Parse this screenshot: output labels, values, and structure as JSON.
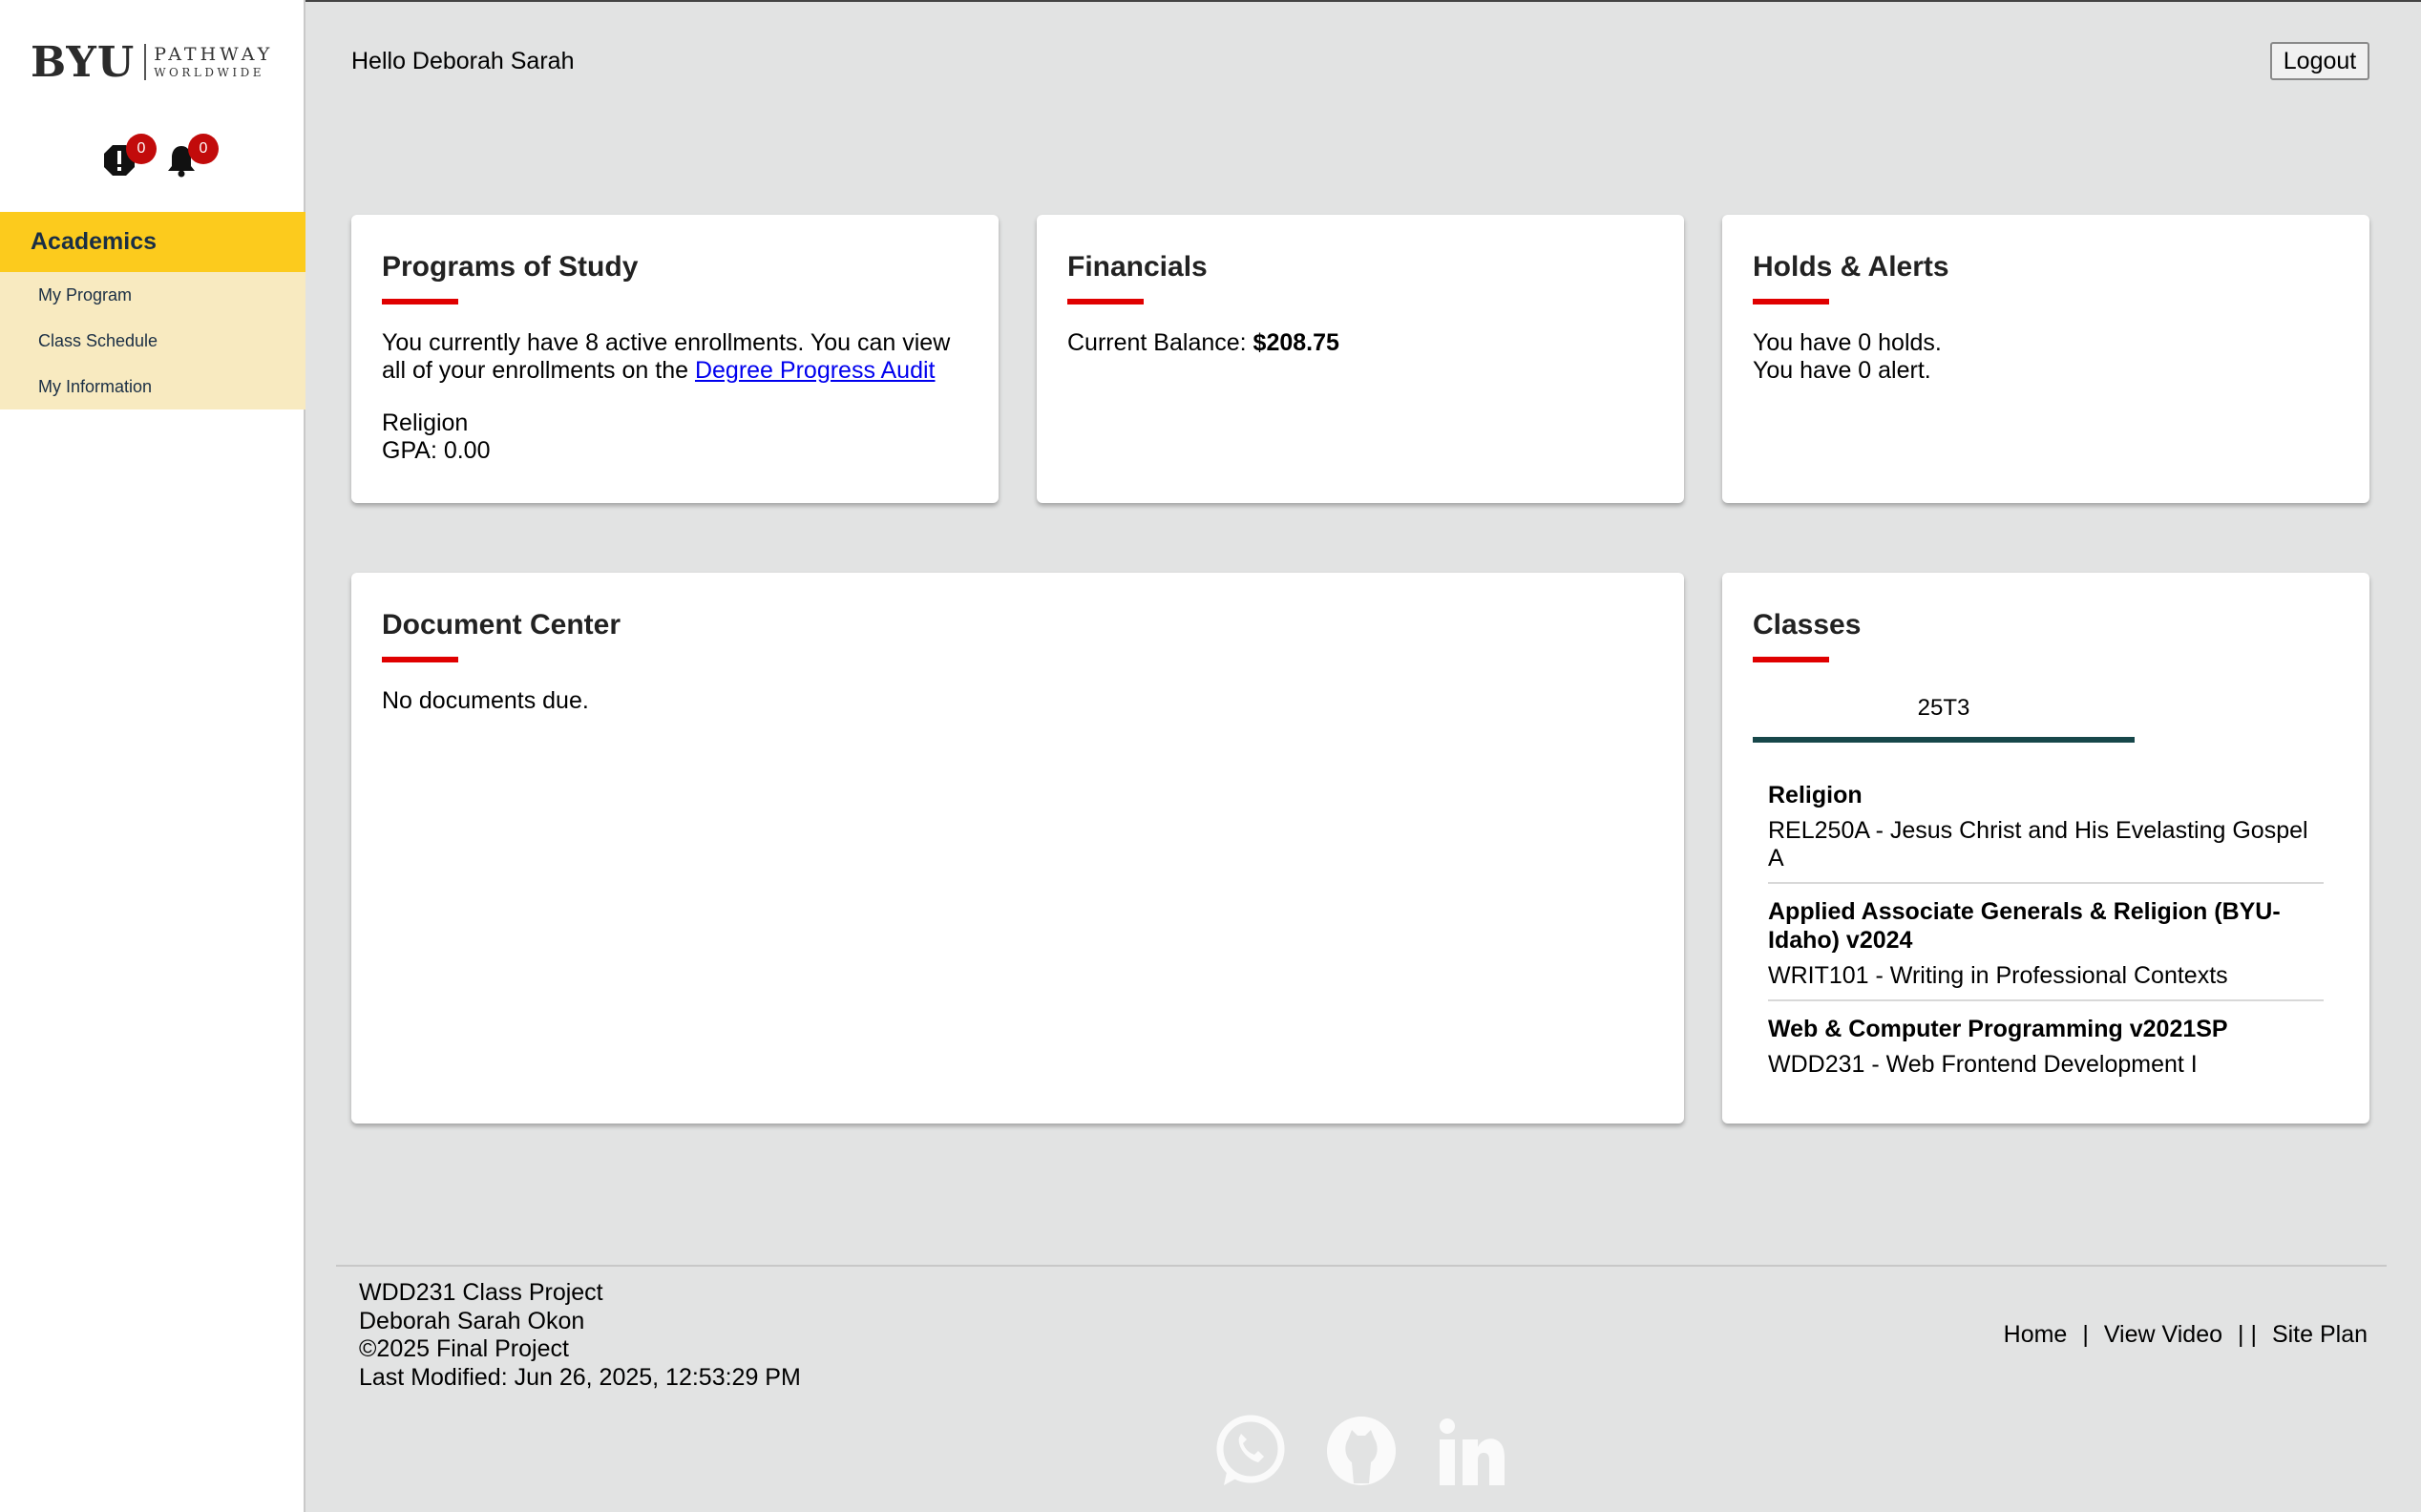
{
  "sidebar": {
    "logo": {
      "brand": "BYU",
      "line1": "PATHWAY",
      "line2": "WORLDWIDE"
    },
    "holds_count": "0",
    "alerts_count": "0",
    "section": "Academics",
    "items": [
      {
        "label": "My Program"
      },
      {
        "label": "Class Schedule"
      },
      {
        "label": "My Information"
      }
    ]
  },
  "header": {
    "greeting": "Hello Deborah Sarah",
    "logout_label": "Logout"
  },
  "programs": {
    "title": "Programs of Study",
    "text_before": "You currently have 8 active enrollments. You can view all of your enrollments on the ",
    "link_text": "Degree Progress Audit",
    "program_name": "Religion",
    "gpa": "GPA: 0.00"
  },
  "financials": {
    "title": "Financials",
    "balance_label": "Current Balance: ",
    "balance_value": "$208.75"
  },
  "holds": {
    "title": "Holds & Alerts",
    "holds_text": "You have 0 holds.",
    "alerts_text": "You have 0 alert."
  },
  "documents": {
    "title": "Document Center",
    "message": "No documents due."
  },
  "classes": {
    "title": "Classes",
    "term_tab": "25T3",
    "items": [
      {
        "program": "Religion",
        "course": "REL250A - Jesus Christ and His Evelasting Gospel A"
      },
      {
        "program": "Applied Associate Generals & Religion (BYU-Idaho) v2024",
        "course": "WRIT101 - Writing in Professional Contexts"
      },
      {
        "program": "Web & Computer Programming v2021SP",
        "course": "WDD231 - Web Frontend Development I"
      }
    ]
  },
  "footer": {
    "line1": "WDD231 Class Project",
    "line2": "Deborah Sarah Okon",
    "line3": "©2025 Final Project",
    "line4": "Last Modified: Jun 26, 2025, 12:53:29 PM",
    "links": [
      "Home",
      "View Video",
      "Site Plan"
    ],
    "sep1": "|",
    "sep2": "| |",
    "social_icons": [
      "whatsapp-icon",
      "github-icon",
      "linkedin-icon"
    ]
  },
  "colors": {
    "accent_yellow": "#fccb1d",
    "accent_red": "#e00000",
    "badge_red": "#c20b0b",
    "tab_teal": "#17474a"
  }
}
